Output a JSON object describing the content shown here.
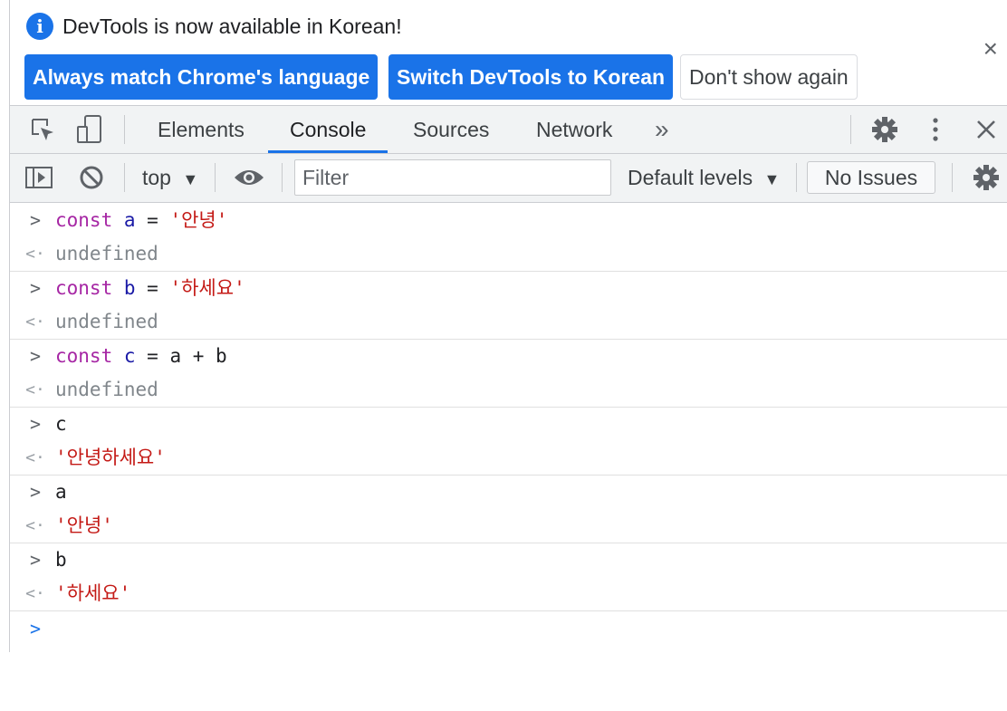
{
  "infobar": {
    "message": "DevTools is now available in Korean!",
    "buttons": {
      "always_match": "Always match Chrome's language",
      "switch_korean": "Switch DevTools to Korean",
      "dont_show": "Don't show again"
    },
    "close_label": "×"
  },
  "tabs": [
    {
      "label": "Elements",
      "active": false
    },
    {
      "label": "Console",
      "active": true
    },
    {
      "label": "Sources",
      "active": false
    },
    {
      "label": "Network",
      "active": false
    }
  ],
  "more_tabs_label": "»",
  "toolbar": {
    "context": "top",
    "filter_placeholder": "Filter",
    "levels": "Default levels",
    "issues": "No Issues"
  },
  "console": {
    "input_prefix": ">",
    "result_prefix": "<·",
    "entries": [
      {
        "input": {
          "kw": "const",
          "var": "a",
          "op": " = ",
          "str": "'안녕'"
        },
        "result": "undefined"
      },
      {
        "input": {
          "kw": "const",
          "var": "b",
          "op": " = ",
          "str": "'하세요'"
        },
        "result": "undefined"
      },
      {
        "input": {
          "kw": "const",
          "var": "c",
          "op": " = ",
          "tail": "a + b"
        },
        "result": "undefined"
      },
      {
        "input_plain": "c",
        "result_str": "'안녕하세요'"
      },
      {
        "input_plain": "a",
        "result_str": "'안녕'"
      },
      {
        "input_plain": "b",
        "result_str": "'하세요'"
      }
    ]
  },
  "colors": {
    "accent": "#1a73e8",
    "keyword": "#a626a4",
    "string": "#c41a16",
    "variable": "#1a1aa6",
    "undefined": "#80868b"
  }
}
